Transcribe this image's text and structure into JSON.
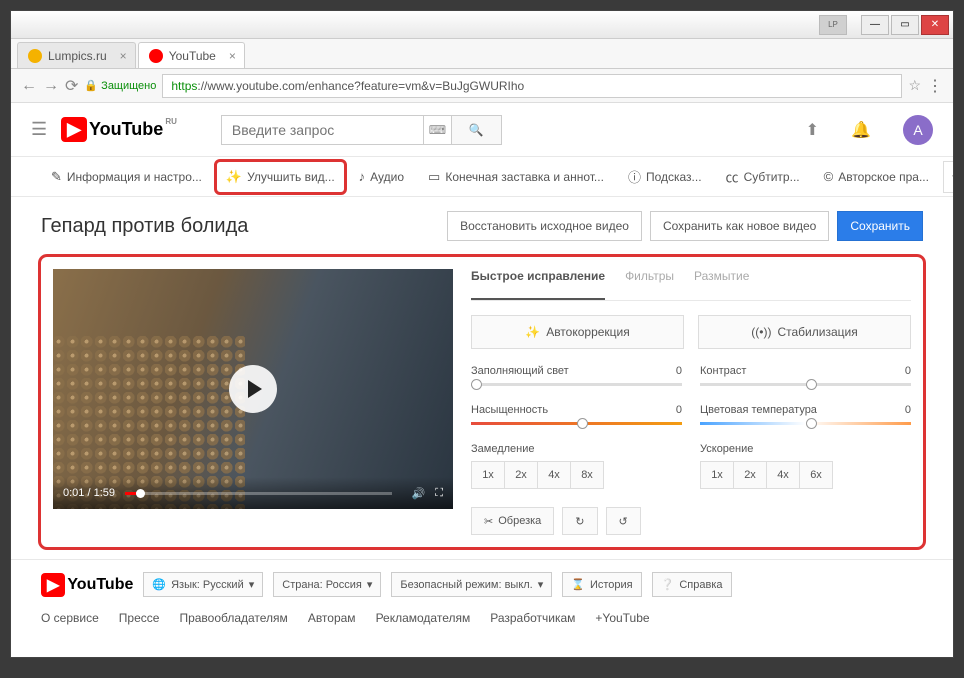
{
  "window": {
    "lp": "LP"
  },
  "tabs": [
    {
      "title": "Lumpics.ru",
      "favColor": "#f5b200"
    },
    {
      "title": "YouTube",
      "favColor": "#f00"
    }
  ],
  "addr": {
    "secure": "Защищено",
    "https": "https",
    "rest": "://www.youtube.com/enhance?feature=vm&v=BuJgGWURIho"
  },
  "yt": {
    "logo": "YouTube",
    "ru": "RU",
    "search_ph": "Введите запрос",
    "avatar": "A"
  },
  "editTabs": {
    "info": "Информация и настро...",
    "improve": "Улучшить вид...",
    "audio": "Аудио",
    "end": "Конечная заставка и аннот...",
    "hints": "Подсказ...",
    "cc": "Субтитр...",
    "copyright": "Авторское пра..."
  },
  "title": "Гепард против болида",
  "actions": {
    "restore": "Восстановить исходное видео",
    "saveAs": "Сохранить как новое видео",
    "save": "Сохранить"
  },
  "player": {
    "time": "0:01 / 1:59"
  },
  "controlTabs": {
    "quick": "Быстрое исправление",
    "filters": "Фильтры",
    "blur": "Размытие"
  },
  "bigbtns": {
    "auto": "Автокоррекция",
    "stab": "Стабилизация"
  },
  "sliders": {
    "fill": {
      "label": "Заполняющий свет",
      "val": "0"
    },
    "contrast": {
      "label": "Контраст",
      "val": "0"
    },
    "sat": {
      "label": "Насыщенность",
      "val": "0"
    },
    "temp": {
      "label": "Цветовая температура",
      "val": "0"
    }
  },
  "speed": {
    "slow": "Замедление",
    "fast": "Ускорение",
    "slowOpts": [
      "1x",
      "2x",
      "4x",
      "8x"
    ],
    "fastOpts": [
      "1x",
      "2x",
      "4x",
      "6x"
    ]
  },
  "trim": {
    "label": "Обрезка"
  },
  "footer": {
    "lang": "Язык: Русский",
    "country": "Страна: Россия",
    "safe": "Безопасный режим: выкл.",
    "history": "История",
    "help": "Справка"
  },
  "links": [
    "О сервисе",
    "Прессе",
    "Правообладателям",
    "Авторам",
    "Рекламодателям",
    "Разработчикам",
    "+YouTube"
  ]
}
